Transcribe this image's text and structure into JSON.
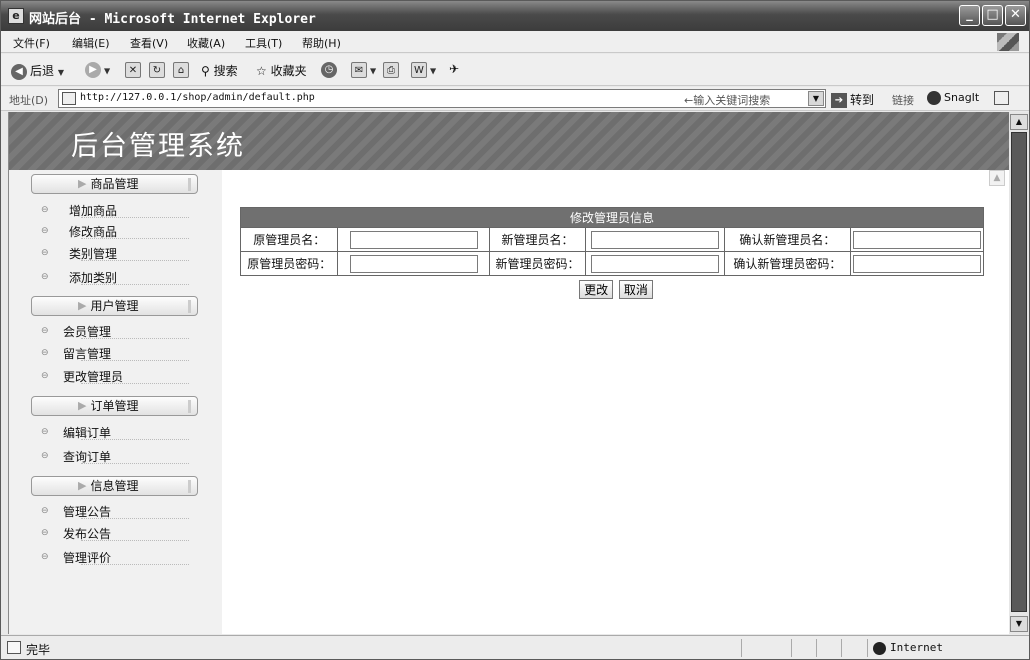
{
  "window": {
    "title": "网站后台 - Microsoft Internet Explorer",
    "min_glyph": "_",
    "max_glyph": "□",
    "close_glyph": "✕"
  },
  "menubar": {
    "items": [
      "文件(F)",
      "编辑(E)",
      "查看(V)",
      "收藏(A)",
      "工具(T)",
      "帮助(H)"
    ]
  },
  "toolbar": {
    "back_label": "后退",
    "search_label": "搜索",
    "favorites_label": "收藏夹"
  },
  "addressbar": {
    "label": "地址(D)",
    "url": "http://127.0.0.1/shop/admin/default.php",
    "keyword_hint": "←输入关键词搜索",
    "go_label": "转到",
    "links_label": "链接",
    "snagit_label": "SnagIt"
  },
  "page": {
    "banner_title": "后台管理系统"
  },
  "sidebar": {
    "sections": [
      {
        "title": "商品管理",
        "items": [
          "增加商品",
          "修改商品",
          "类别管理",
          "添加类别"
        ]
      },
      {
        "title": "用户管理",
        "items": [
          "会员管理",
          "留言管理",
          "更改管理员"
        ]
      },
      {
        "title": "订单管理",
        "items": [
          "编辑订单",
          "查询订单"
        ]
      },
      {
        "title": "信息管理",
        "items": [
          "管理公告",
          "发布公告",
          "管理评价"
        ]
      }
    ]
  },
  "form": {
    "caption": "修改管理员信息",
    "labels": {
      "old_name": "原管理员名：",
      "new_name": "新管理员名：",
      "confirm_name": "确认新管理员名：",
      "old_password": "原管理员密码：",
      "new_password": "新管理员密码：",
      "confirm_password": "确认新管理员密码："
    },
    "values": {
      "old_name": "",
      "new_name": "",
      "confirm_name": "",
      "old_password": "",
      "new_password": "",
      "confirm_password": ""
    },
    "submit_label": "更改",
    "cancel_label": "取消"
  },
  "statusbar": {
    "text": "完毕",
    "zone": "Internet"
  }
}
